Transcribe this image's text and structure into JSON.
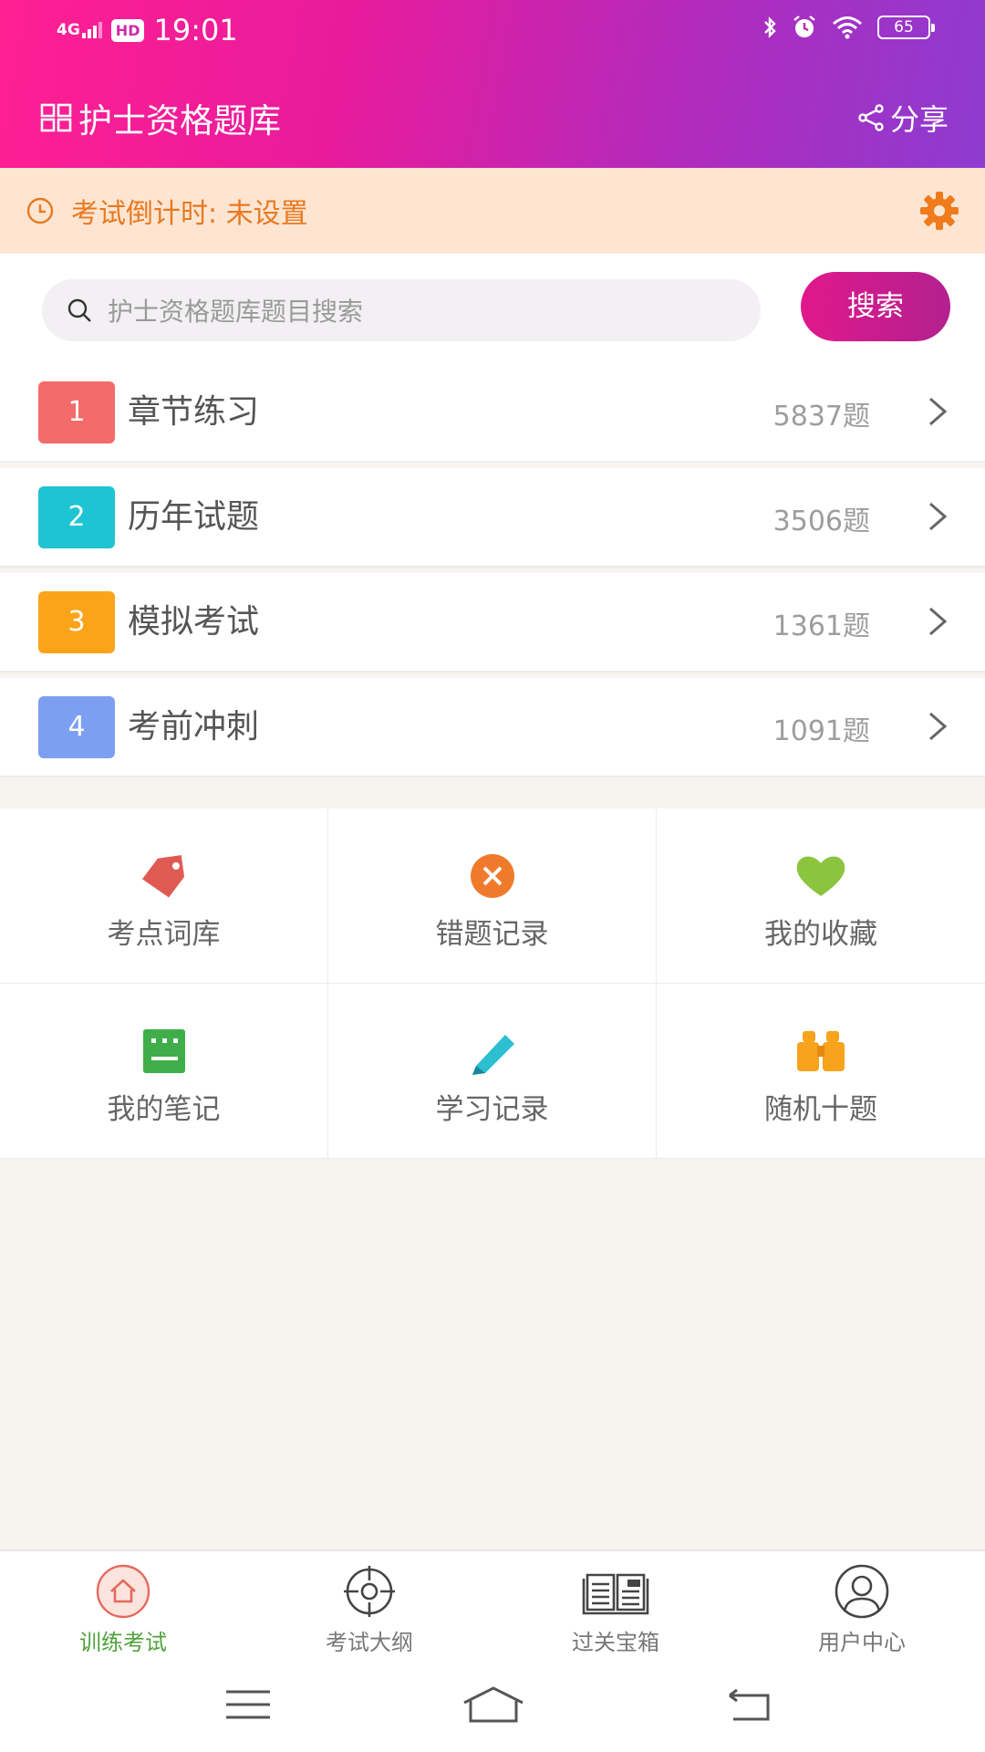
{
  "status_bar": {
    "network": "4G",
    "hd": "HD",
    "time": "19:01",
    "battery": "65"
  },
  "header": {
    "title": "护士资格题库",
    "share_label": "分享"
  },
  "countdown": {
    "text": "考试倒计时: 未设置"
  },
  "search": {
    "placeholder": "护士资格题库题目搜索",
    "button": "搜索"
  },
  "practice_list": [
    {
      "index": "1",
      "title": "章节练习",
      "count": "5837题",
      "color": "#f46b6b"
    },
    {
      "index": "2",
      "title": "历年试题",
      "count": "3506题",
      "color": "#1ec4d2"
    },
    {
      "index": "3",
      "title": "模拟考试",
      "count": "1361题",
      "color": "#fba41a"
    },
    {
      "index": "4",
      "title": "考前冲刺",
      "count": "1091题",
      "color": "#7d9ff2"
    }
  ],
  "tools": [
    {
      "label": "考点词库",
      "icon": "tag-icon"
    },
    {
      "label": "错题记录",
      "icon": "wrong-x-icon"
    },
    {
      "label": "我的收藏",
      "icon": "heart-icon"
    },
    {
      "label": "我的笔记",
      "icon": "note-icon"
    },
    {
      "label": "学习记录",
      "icon": "pencil-icon"
    },
    {
      "label": "随机十题",
      "icon": "binoculars-icon"
    }
  ],
  "bottom_nav": [
    {
      "label": "训练考试",
      "icon": "home-icon",
      "active": true
    },
    {
      "label": "考试大纲",
      "icon": "target-icon",
      "active": false
    },
    {
      "label": "过关宝箱",
      "icon": "newspaper-icon",
      "active": false
    },
    {
      "label": "用户中心",
      "icon": "user-icon",
      "active": false
    }
  ],
  "colors": {
    "accent": "#e0188c",
    "countdown_text": "#e8791f",
    "active_nav": "#4fa23b"
  }
}
